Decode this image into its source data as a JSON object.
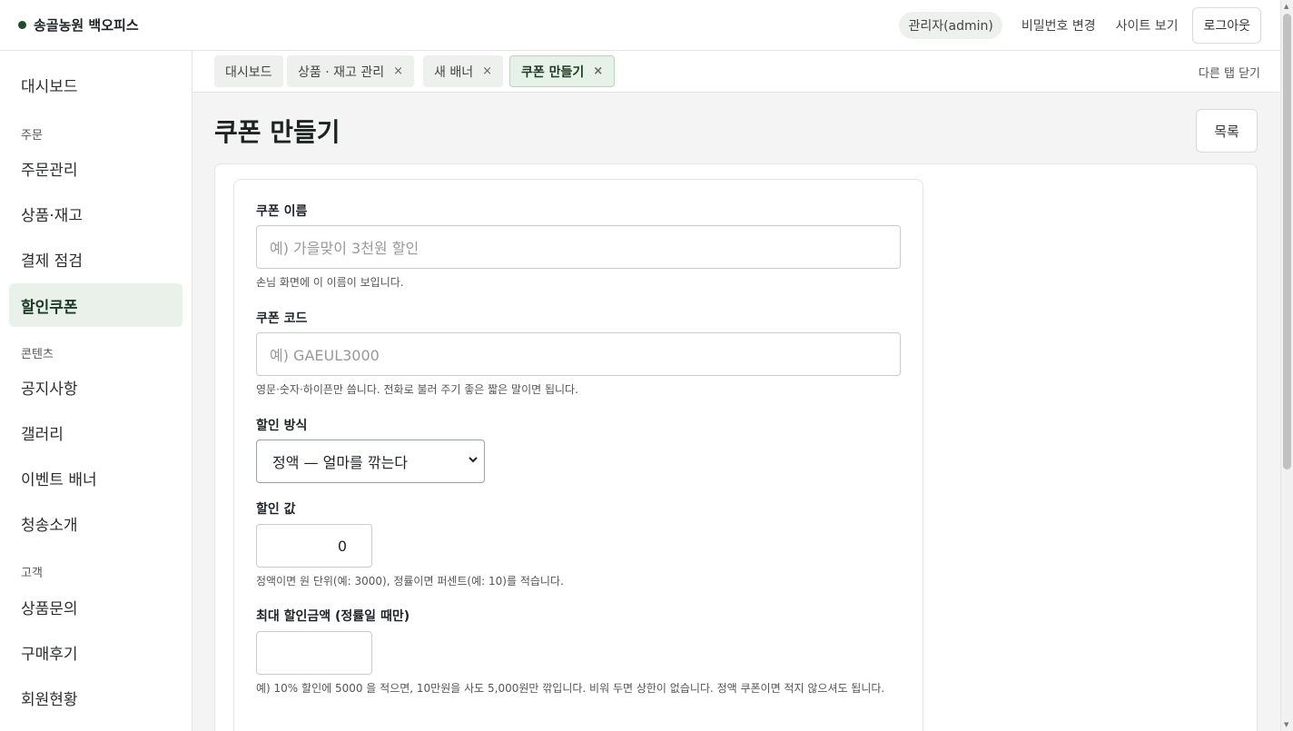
{
  "header": {
    "brand": "송골농원 백오피스",
    "user": "관리자(admin)",
    "change_password": "비밀번호 변경",
    "view_site": "사이트 보기",
    "logout": "로그아웃"
  },
  "sidebar": {
    "dashboard": "대시보드",
    "groups": [
      {
        "label": "주문",
        "items": [
          "주문관리",
          "상품·재고",
          "결제 점검",
          "할인쿠폰"
        ]
      },
      {
        "label": "콘텐츠",
        "items": [
          "공지사항",
          "갤러리",
          "이벤트 배너",
          "청송소개"
        ]
      },
      {
        "label": "고객",
        "items": [
          "상품문의",
          "구매후기",
          "회원현황"
        ]
      }
    ],
    "active_item": "할인쿠폰"
  },
  "tabs": {
    "items": [
      {
        "label": "대시보드",
        "closable": false
      },
      {
        "label": "상품 · 재고 관리",
        "closable": true
      },
      {
        "label": "새 배너",
        "closable": true
      },
      {
        "label": "쿠폰 만들기",
        "closable": true,
        "active": true
      }
    ],
    "close_x": "×",
    "close_others": "다른 탭 닫기"
  },
  "page": {
    "title": "쿠폰 만들기",
    "list_button": "목록"
  },
  "form": {
    "coupon_name": {
      "label": "쿠폰 이름",
      "placeholder": "예) 가을맞이 3천원 할인",
      "help": "손님 화면에 이 이름이 보입니다."
    },
    "coupon_code": {
      "label": "쿠폰 코드",
      "placeholder": "예) GAEUL3000",
      "help": "영문·숫자·하이픈만 씁니다. 전화로 불러 주기 좋은 짧은 말이면 됩니다."
    },
    "discount_type": {
      "label": "할인 방식",
      "selected": "정액 — 얼마를 깎는다"
    },
    "discount_value": {
      "label": "할인 값",
      "value": "0",
      "help": "정액이면 원 단위(예: 3000), 정률이면 퍼센트(예: 10)를 적습니다."
    },
    "max_discount": {
      "label": "최대 할인금액 (정률일 때만)",
      "value": "",
      "help": "예) 10% 할인에 5000 을 적으면, 10만원을 사도 5,000원만 깎입니다. 비워 두면 상한이 없습니다. 정액 쿠폰이면 적지 않으셔도 됩니다."
    }
  },
  "colors": {
    "brand_dot": "#1f4d2b",
    "active_bg": "#e9f1ea"
  }
}
